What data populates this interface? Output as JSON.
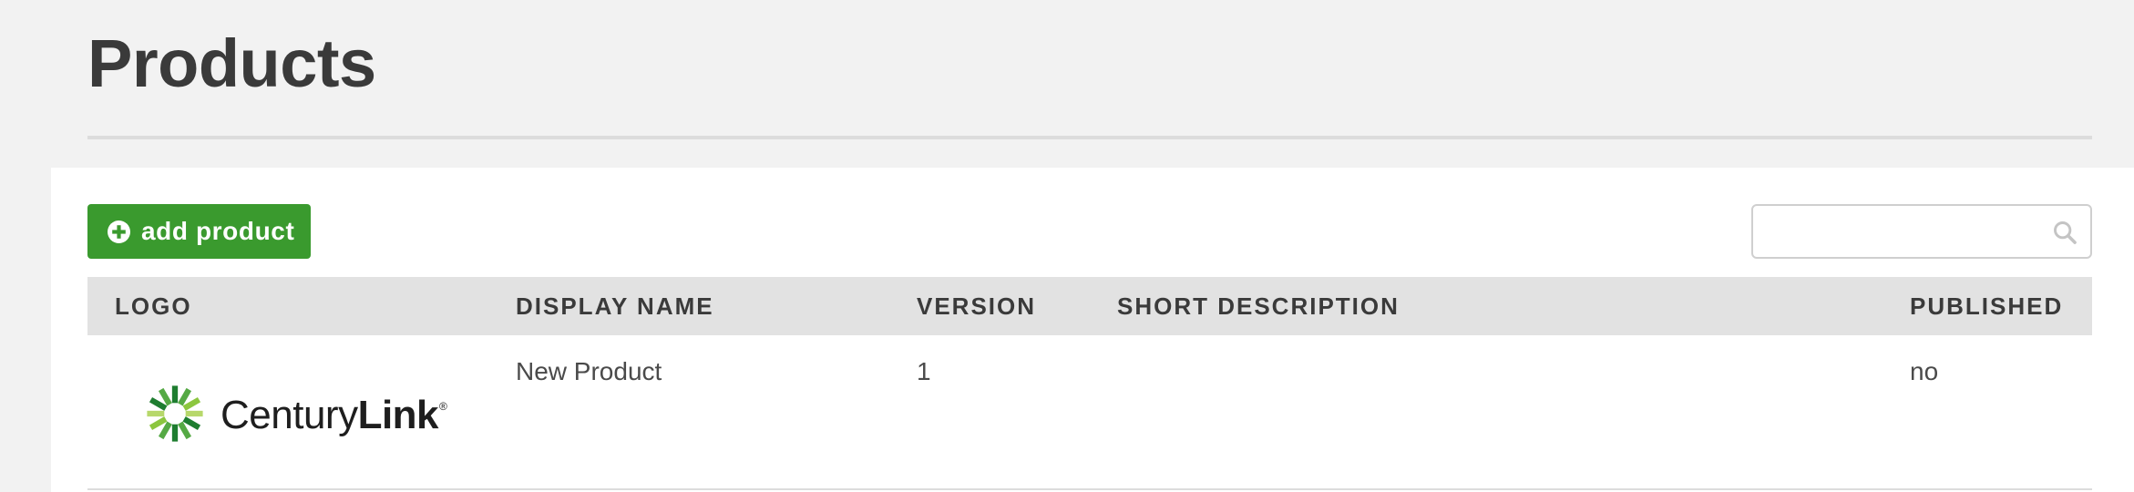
{
  "page": {
    "title": "Products"
  },
  "toolbar": {
    "add_label": "add product",
    "add_icon": "plus-circle-icon",
    "search_placeholder": "",
    "search_value": "",
    "search_icon": "search-icon"
  },
  "table": {
    "columns": [
      "LOGO",
      "DISPLAY NAME",
      "VERSION",
      "SHORT DESCRIPTION",
      "PUBLISHED"
    ],
    "rows": [
      {
        "logo": {
          "wordmark_regular": "Century",
          "wordmark_bold": "Link",
          "registered": "®"
        },
        "display_name": "New Product",
        "version": "1",
        "short_description": "",
        "published": "no"
      }
    ]
  },
  "colors": {
    "accent_green": "#3a9a2e",
    "header_bg": "#e2e2e2",
    "page_bg": "#f2f2f2"
  }
}
